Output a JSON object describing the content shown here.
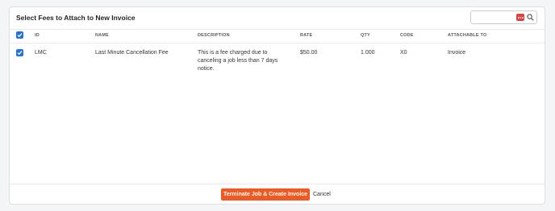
{
  "modal": {
    "title": "Select Fees to Attach to New Invoice",
    "search": {
      "placeholder": "",
      "value": ""
    }
  },
  "table": {
    "columns": [
      "ID",
      "NAME",
      "DESCRIPTION",
      "RATE",
      "QTY",
      "CODE",
      "ATTACHABLE TO"
    ],
    "rows": [
      {
        "id": "LMC",
        "name": "Last Minute Cancellation Fee",
        "description": "This is a fee charged due to canceling a job less than 7 days notice.",
        "rate": "$50.00",
        "qty": "1.000",
        "code": "X0",
        "attachable_to": "Invoice",
        "selected": true
      }
    ],
    "select_all": true
  },
  "footer": {
    "primary_label": "Terminate Job & Create Invoice",
    "cancel_label": "Cancel"
  },
  "colors": {
    "accent_orange": "#f05a22",
    "checkbox_blue": "#1e73d8",
    "dots_red": "#e0413b"
  },
  "icons": [
    "search-icon",
    "more-options-icon",
    "check-icon"
  ]
}
